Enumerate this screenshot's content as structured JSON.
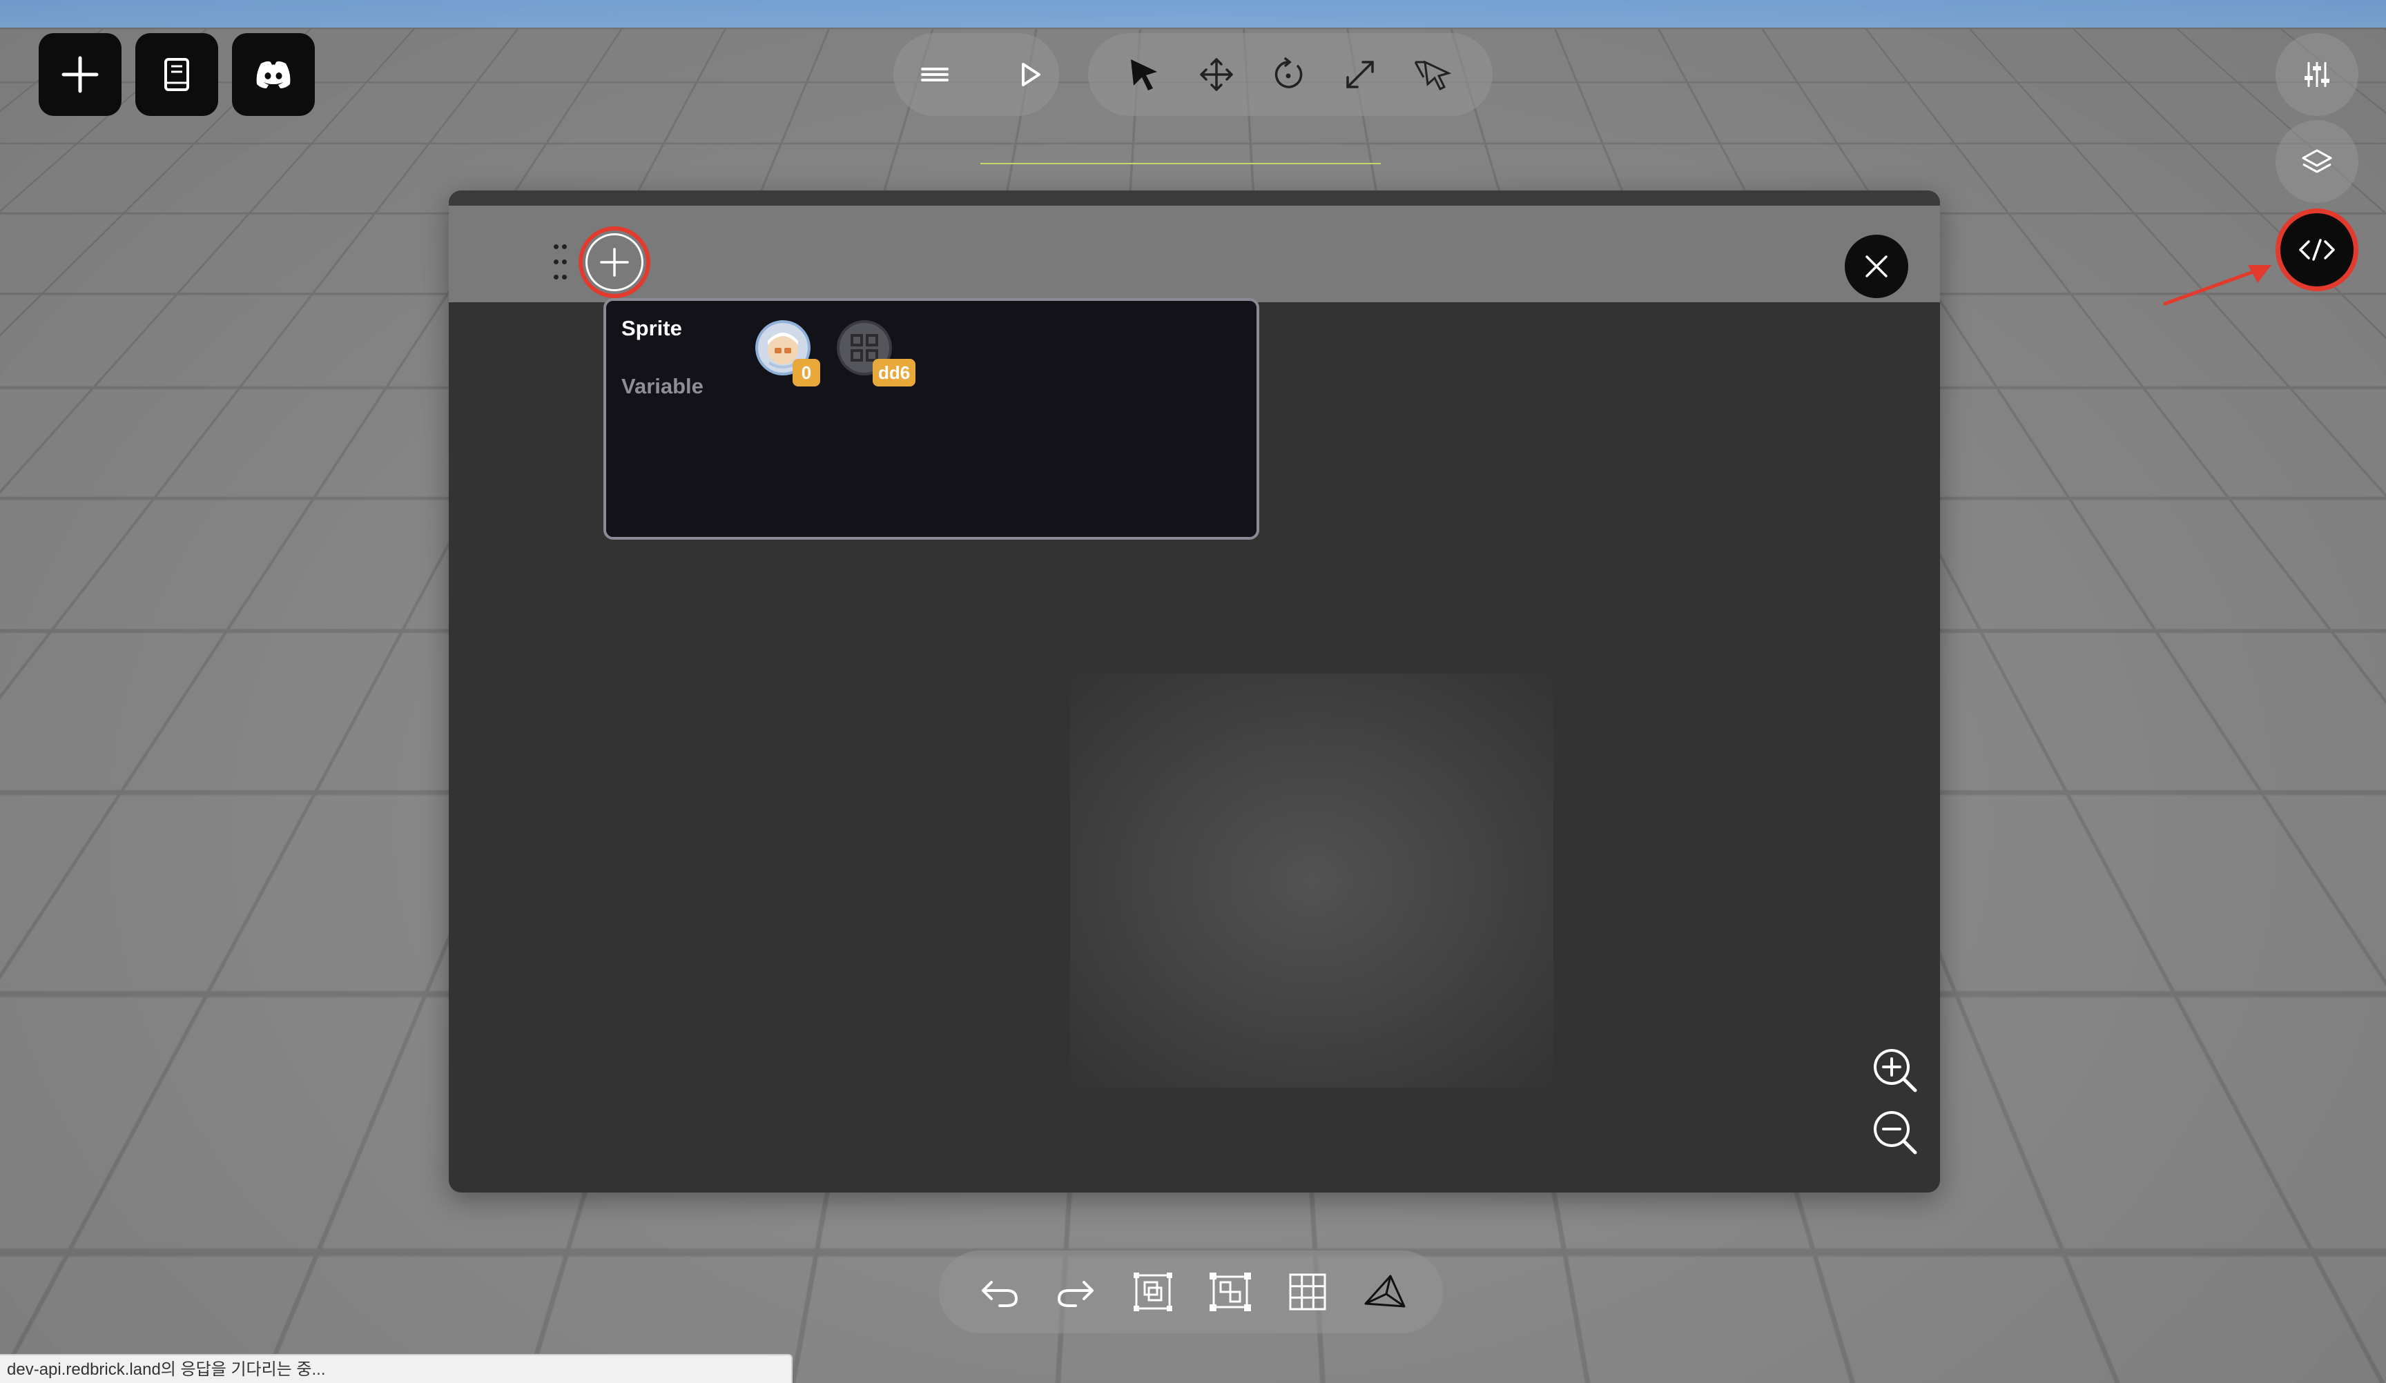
{
  "top_left": {
    "buttons": [
      {
        "name": "add",
        "icon": "plus-icon"
      },
      {
        "name": "docs",
        "icon": "book-icon"
      },
      {
        "name": "discord",
        "icon": "discord-icon"
      }
    ]
  },
  "toolbar": {
    "tools": [
      "menu-icon",
      "play-icon",
      "select-cursor-icon",
      "move-icon",
      "rotate-icon",
      "scale-icon",
      "multi-select-icon"
    ]
  },
  "right_panel": {
    "buttons": [
      "settings-sliders-icon",
      "layers-icon",
      "code-icon"
    ]
  },
  "code_panel": {
    "popup": {
      "tabs": [
        "Sprite",
        "Variable"
      ],
      "active_tab": "Sprite",
      "sprites": [
        {
          "icon": "character-avatar-icon",
          "badge": "0"
        },
        {
          "icon": "object-placeholder-icon",
          "badge": "dd6"
        }
      ]
    }
  },
  "bottom_toolbar": {
    "tools": [
      "undo-icon",
      "redo-icon",
      "duplicate-icon",
      "group-icon",
      "grid-icon",
      "camera-icon"
    ]
  },
  "status_bar": {
    "text": "dev-api.redbrick.land의 응답을 기다리는 중..."
  },
  "colors": {
    "highlight": "#e23b2e",
    "badge": "#e8a93a",
    "panel": "#333333",
    "panel_header": "#7a7a7a"
  }
}
